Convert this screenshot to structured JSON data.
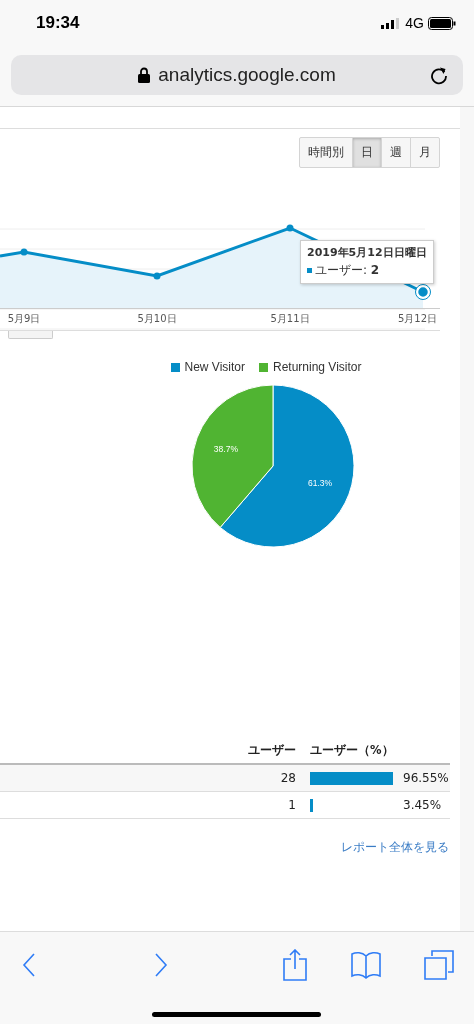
{
  "status_bar": {
    "time": "19:34",
    "network": "4G"
  },
  "address_bar": {
    "url": "analytics.google.com"
  },
  "period_buttons": [
    {
      "label": "時間別",
      "selected": false
    },
    {
      "label": "日",
      "selected": true
    },
    {
      "label": "週",
      "selected": false
    },
    {
      "label": "月",
      "selected": false
    }
  ],
  "line_chart": {
    "x_labels": [
      "5月9日",
      "5月10日",
      "5月11日",
      "5月12日"
    ],
    "tooltip": {
      "title": "2019年5月12日日曜日",
      "metric": "ユーザー: ",
      "value": "2"
    }
  },
  "pie_chart": {
    "chart_data": {
      "type": "pie",
      "categories": [
        "New Visitor",
        "Returning Visitor"
      ],
      "values": [
        61.3,
        38.7
      ],
      "colors": [
        "#058dc7",
        "#50b432"
      ],
      "value_labels": [
        "61.3%",
        "38.7%"
      ]
    }
  },
  "table": {
    "columns": [
      "ユーザー",
      "ユーザー（%）"
    ],
    "rows": [
      {
        "users": "28",
        "level": 0.9655,
        "percent": "96.55%"
      },
      {
        "users": "1",
        "level": 0.0345,
        "percent": "3.45%"
      }
    ]
  },
  "report_link": "レポート全体を見る"
}
